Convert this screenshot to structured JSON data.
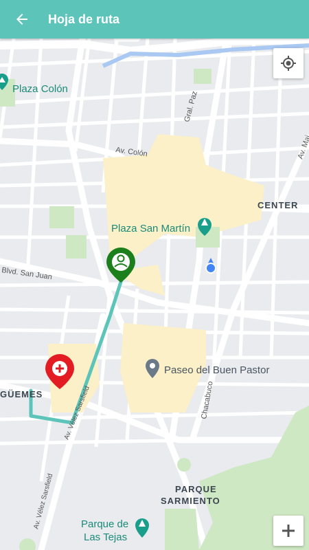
{
  "appbar": {
    "title": "Hoja de ruta",
    "back_icon": "arrow-left-icon"
  },
  "controls": {
    "locate_icon": "my-location-icon",
    "zoom_in_icon": "plus-icon"
  },
  "map": {
    "places": {
      "plaza_colon": "Plaza Colón",
      "plaza_san_martin": "Plaza San Martín",
      "paseo_buen_pastor": "Paseo del Buen Pastor",
      "parque_las_tejas_1": "Parque de",
      "parque_las_tejas_2": "Las Tejas"
    },
    "areas": {
      "center": "CENTER",
      "guemes": "GÜEMES",
      "parque_sarmiento_1": "PARQUE",
      "parque_sarmiento_2": "SARMIENTO"
    },
    "streets": {
      "gral_paz": "Gral. Paz",
      "av_colon": "Av. Colón",
      "av_maipu": "Av. Mai",
      "blvd_san_juan": "Blvd. San Juan",
      "av_velez_1": "Av. Vélez Sarsfield",
      "av_velez_2": "Av. Vélez Sarsfield",
      "chacabuco": "Chacabuco"
    },
    "markers": {
      "origin_icon": "person-marker-icon",
      "destination_icon": "red-cross-marker-icon",
      "current_location_icon": "blue-dot-icon"
    },
    "colors": {
      "route": "#5cc4b8",
      "origin": "#1b7f1b",
      "destination": "#e31b23",
      "park": "#cfe8c4",
      "poi_teal": "#1a9e8c"
    }
  }
}
